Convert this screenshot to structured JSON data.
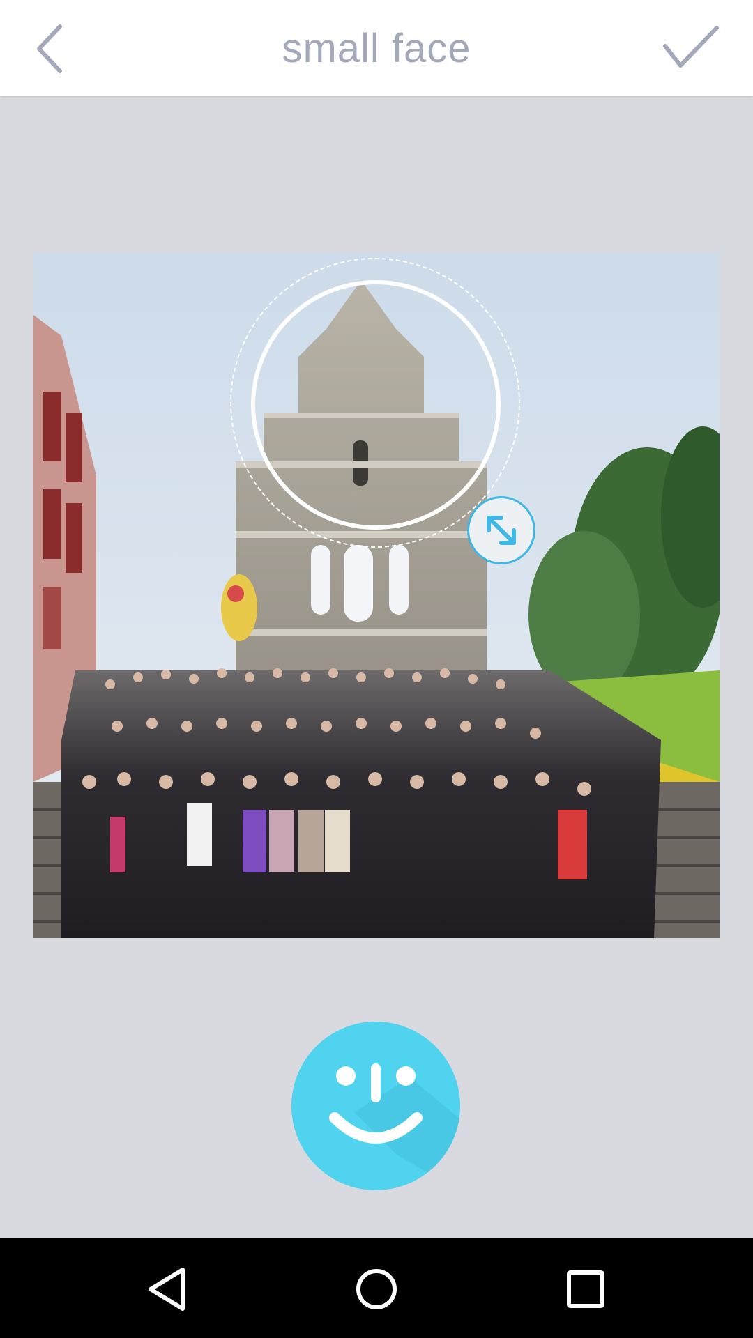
{
  "header": {
    "title": "small face",
    "back_icon": "chevron-left-icon",
    "confirm_icon": "checkmark-icon"
  },
  "editor": {
    "selection_handle_icon": "resize-diagonal-icon",
    "smile_button_icon": "smiley-face-icon"
  },
  "navbar": {
    "back_icon": "nav-back-icon",
    "home_icon": "nav-home-icon",
    "recents_icon": "nav-recents-icon"
  },
  "colors": {
    "header_text": "#a3a8ba",
    "canvas_background": "#d8dadf",
    "accent": "#4fd3ee",
    "handle_border": "#3fb8e6"
  }
}
